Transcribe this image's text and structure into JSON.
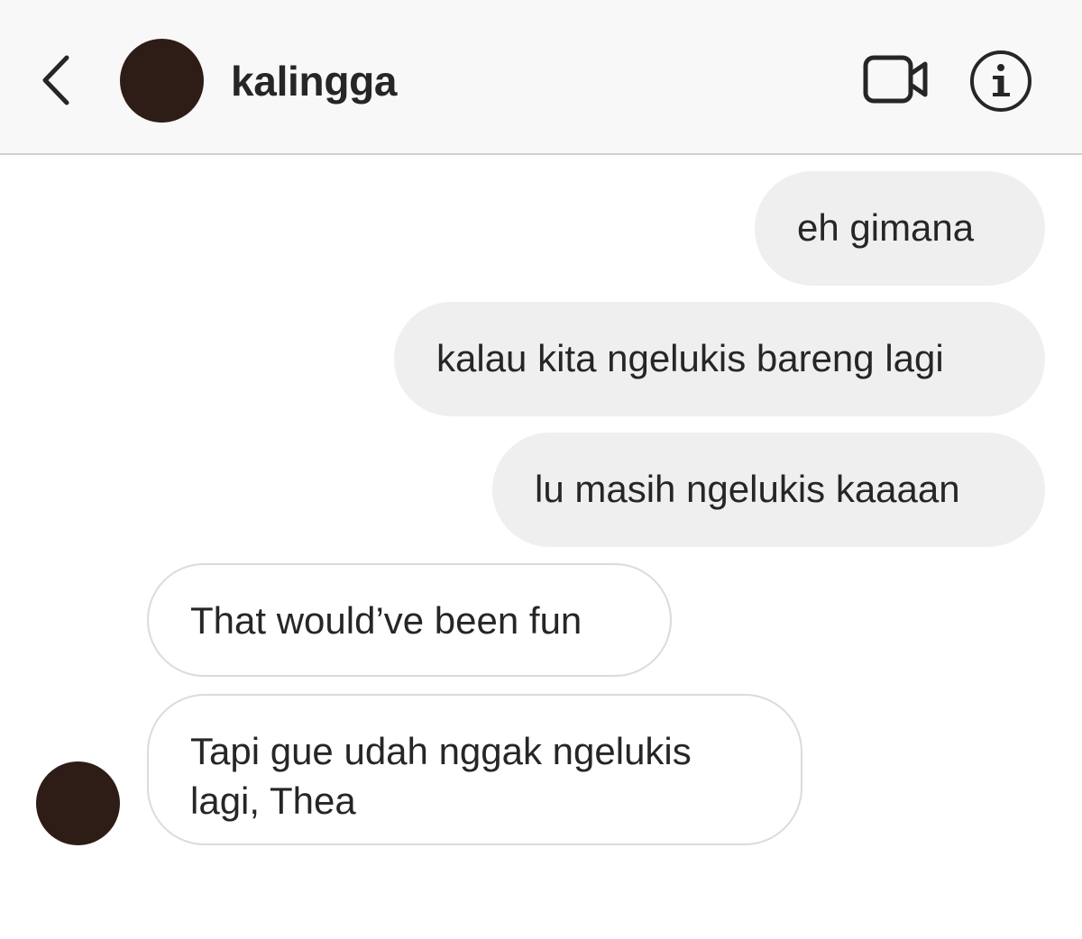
{
  "header": {
    "username": "kalingga",
    "back_icon": "chevron-left-icon",
    "video_icon": "video-camera-icon",
    "info_icon": "info-icon"
  },
  "messages": [
    {
      "sender": "me",
      "text": "eh gimana"
    },
    {
      "sender": "me",
      "text": "kalau kita ngelukis bareng lagi"
    },
    {
      "sender": "me",
      "text": "lu masih ngelukis kaaaan"
    },
    {
      "sender": "them",
      "text": "That would’ve been fun"
    },
    {
      "sender": "them",
      "lines": [
        "Tapi gue udah nggak ngelukis",
        "lagi, Thea"
      ]
    }
  ],
  "colors": {
    "header_bg": "#f8f8f8",
    "sent_bubble": "#efefef",
    "received_border": "#dbdbdb",
    "avatar": "#2e1d17",
    "text": "#262626"
  }
}
